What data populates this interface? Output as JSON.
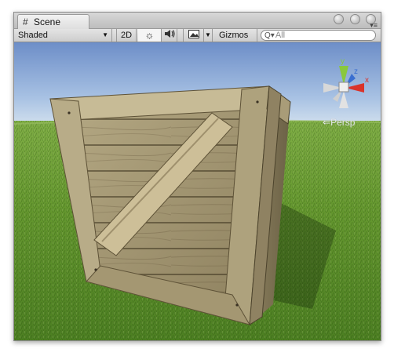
{
  "window": {
    "tab_icon": "#",
    "tab_label": "Scene"
  },
  "toolbar": {
    "shading_mode": "Shaded",
    "mode_2d": "2D",
    "lighting_icon": "☼",
    "audio_icon": "🔊",
    "effects_icon": "▣",
    "gizmos_label": "Gizmos",
    "search_placeholder": "All",
    "search_prefix": "Q▾"
  },
  "viewport": {
    "camera_mode": "Persp",
    "axes": {
      "y": "y",
      "x": "x",
      "z": "z"
    }
  },
  "colors": {
    "axis_x": "#d9332a",
    "axis_y": "#8ac83c",
    "axis_z": "#3a6fd0",
    "sky": "#8fb0dd",
    "grass": "#5f922e",
    "crate_wood": "#a89a72"
  }
}
